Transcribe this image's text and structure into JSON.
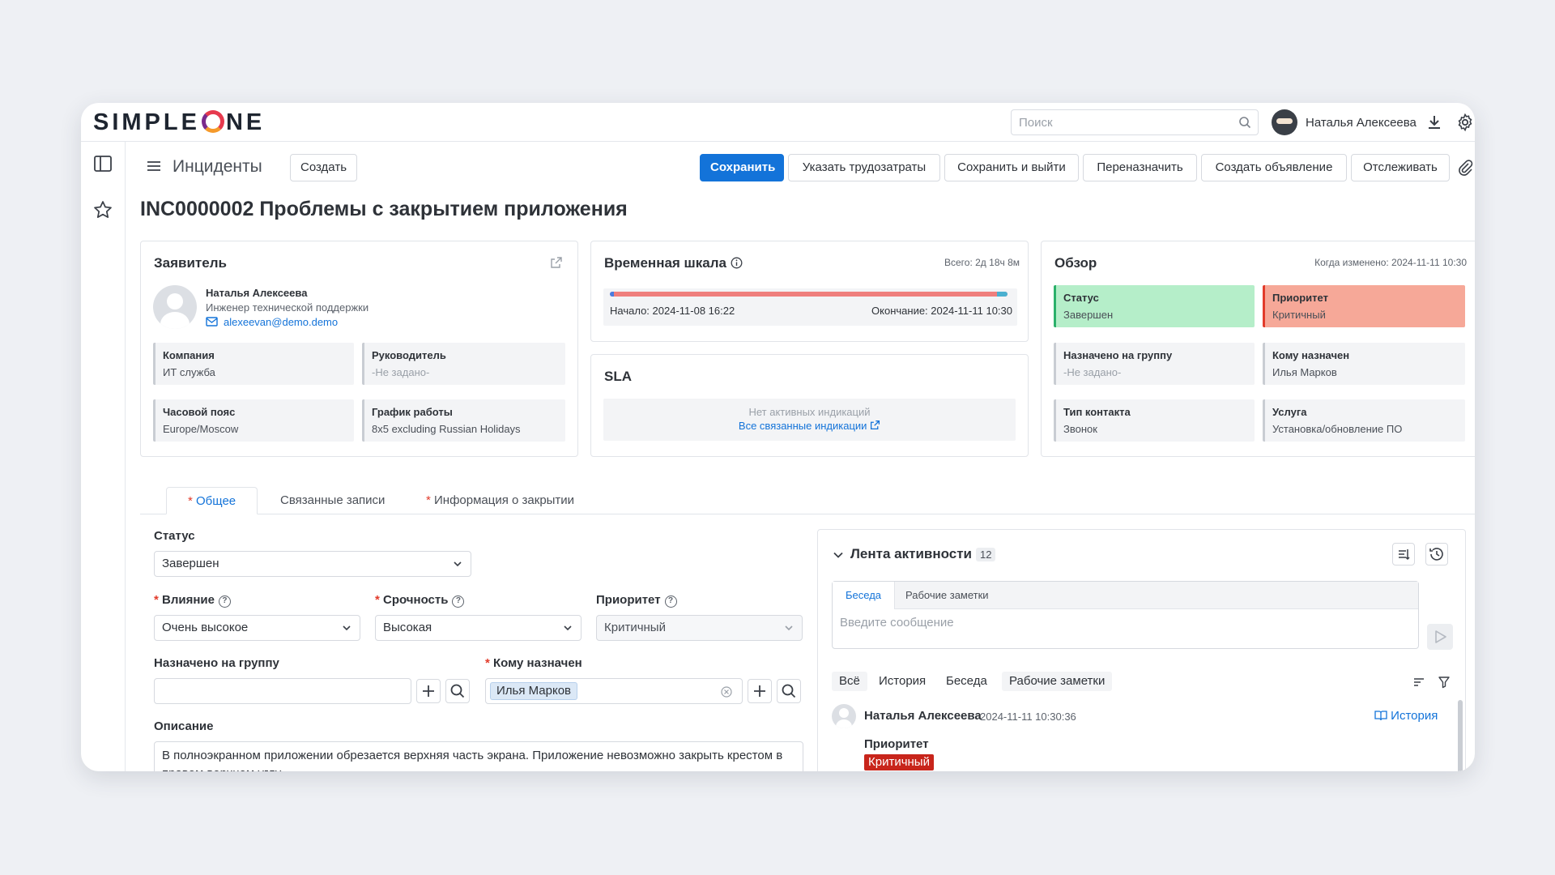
{
  "brand": {
    "logo_left": "SIMPLE",
    "logo_right": "NE"
  },
  "topbar": {
    "search_placeholder": "Поиск",
    "user_name": "Наталья Алексеева"
  },
  "header": {
    "section": "Инциденты",
    "create": "Создать",
    "actions": [
      "Сохранить",
      "Указать трудозатраты",
      "Сохранить и выйти",
      "Переназначить",
      "Создать объявление",
      "Отслеживать"
    ]
  },
  "title": "INC0000002 Проблемы с закрытием приложения",
  "requester": {
    "title": "Заявитель",
    "name": "Наталья Алексеева",
    "role": "Инженер технической поддержки",
    "email": "alexeevan@demo.demo",
    "fields": [
      {
        "label": "Компания",
        "value": "ИТ служба"
      },
      {
        "label": "Руководитель",
        "value": "-Не задано-"
      },
      {
        "label": "Часовой пояс",
        "value": "Europe/Moscow"
      },
      {
        "label": "График работы",
        "value": "8x5 excluding Russian Holidays"
      }
    ]
  },
  "timeline": {
    "title": "Временная шкала",
    "total": "Всего: 2д 18ч 8м",
    "start": "Начало: 2024-11-08 16:22",
    "end": "Окончание: 2024-11-11 10:30"
  },
  "sla": {
    "title": "SLA",
    "empty": "Нет активных индикаций",
    "link": "Все связанные индикации"
  },
  "overview": {
    "title": "Обзор",
    "changed": "Когда изменено: 2024-11-11 10:30",
    "fields": [
      {
        "label": "Статус",
        "value": "Завершен"
      },
      {
        "label": "Приоритет",
        "value": "Критичный"
      },
      {
        "label": "Назначено на группу",
        "value": "-Не задано-"
      },
      {
        "label": "Кому назначен",
        "value": "Илья Марков"
      },
      {
        "label": "Тип контакта",
        "value": "Звонок"
      },
      {
        "label": "Услуга",
        "value": "Установка/обновление ПО"
      }
    ]
  },
  "tabs": [
    {
      "label": "Общее",
      "required": true
    },
    {
      "label": "Связанные записи",
      "required": false
    },
    {
      "label": "Информация о закрытии",
      "required": true
    }
  ],
  "form": {
    "status_label": "Статус",
    "status_value": "Завершен",
    "impact_label": "Влияние",
    "impact_value": "Очень высокое",
    "urgency_label": "Срочность",
    "urgency_value": "Высокая",
    "priority_label": "Приоритет",
    "priority_value": "Критичный",
    "group_label": "Назначено на группу",
    "assignee_label": "Кому назначен",
    "assignee_value": "Илья Марков",
    "description_label": "Описание",
    "description_value": "В полноэкранном приложении обрезается верхняя часть экрана. Приложение невозможно закрыть крестом в правом верхнем углу."
  },
  "activity": {
    "title": "Лента активности",
    "count": "12",
    "tabs": [
      "Беседа",
      "Рабочие заметки"
    ],
    "placeholder": "Введите сообщение",
    "filters": [
      "Всё",
      "История",
      "Беседа",
      "Рабочие заметки"
    ],
    "entry": {
      "author": "Наталья Алексеева",
      "time": "2024-11-11 10:30:36",
      "history": "История",
      "field": "Приоритет",
      "value": "Критичный"
    }
  }
}
